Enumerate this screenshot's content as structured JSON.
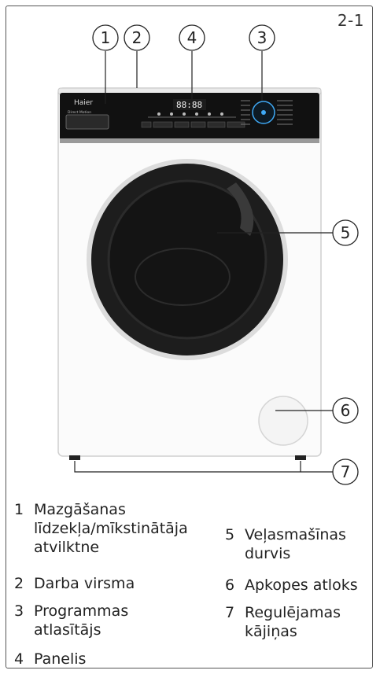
{
  "page_number": "2-1",
  "callouts": [
    "1",
    "2",
    "3",
    "4",
    "5",
    "6",
    "7"
  ],
  "machine": {
    "brand": "Haier",
    "drawer_label": "Direct Motion",
    "display_digits": "88:88"
  },
  "legend": [
    {
      "num": "1",
      "text": "Mazgāšanas līdzekļa/mīkstinātāja atvilktne"
    },
    {
      "num": "2",
      "text": "Darba virsma"
    },
    {
      "num": "3",
      "text": "Programmas atlasītājs"
    },
    {
      "num": "4",
      "text": "Panelis"
    },
    {
      "num": "5",
      "text": "Veļasmašīnas durvis"
    },
    {
      "num": "6",
      "text": "Apkopes atloks"
    },
    {
      "num": "7",
      "text": "Regulējamas kājiņas"
    }
  ]
}
